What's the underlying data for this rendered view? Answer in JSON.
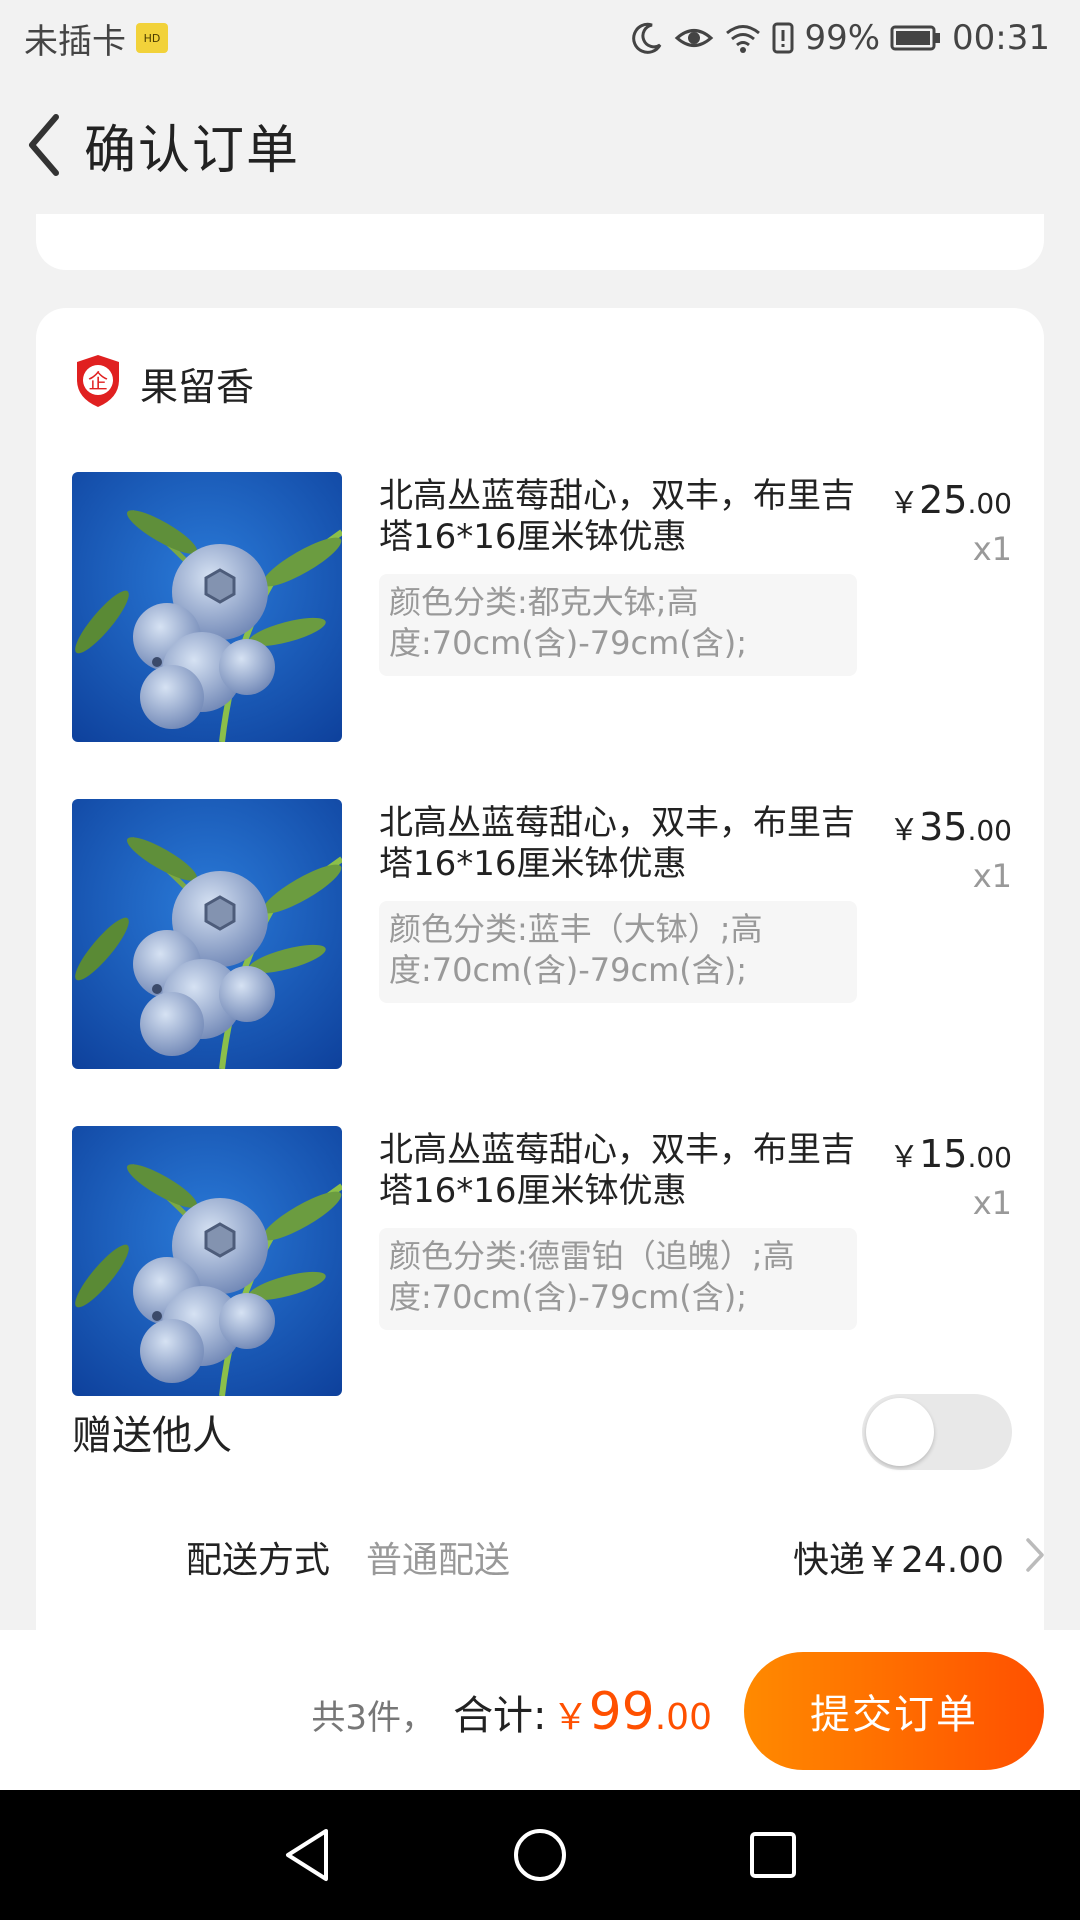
{
  "status_bar": {
    "carrier": "未插卡",
    "sim_badge": "HD",
    "battery": "99%",
    "time": "00:31",
    "icons": [
      "moon-icon",
      "eye-icon",
      "wifi-icon",
      "alert-icon",
      "battery-icon"
    ]
  },
  "header": {
    "back_icon": "chevron-left-icon",
    "title": "确认订单"
  },
  "shop": {
    "icon": "enterprise-shield-icon",
    "badge_char": "企",
    "name": "果留香"
  },
  "items": [
    {
      "title": "北高丛蓝莓甜心，双丰，布里吉塔16*16厘米钵优惠",
      "sku": "颜色分类:都克大钵;高度:70cm(含)-79cm(含);",
      "price_symbol": "￥",
      "price_int": "25",
      "price_dec": ".00",
      "qty": "x1"
    },
    {
      "title": "北高丛蓝莓甜心，双丰，布里吉塔16*16厘米钵优惠",
      "sku": "颜色分类:蓝丰（大钵）;高度:70cm(含)-79cm(含);",
      "price_symbol": "￥",
      "price_int": "35",
      "price_dec": ".00",
      "qty": "x1"
    },
    {
      "title": "北高丛蓝莓甜心，双丰，布里吉塔16*16厘米钵优惠",
      "sku": "颜色分类:德雷铂（追魄）;高度:70cm(含)-79cm(含);",
      "price_symbol": "￥",
      "price_int": "15",
      "price_dec": ".00",
      "qty": "x1"
    }
  ],
  "gift": {
    "label": "赠送他人",
    "enabled": false
  },
  "shipping": {
    "label": "配送方式",
    "method": "普通配送",
    "price": "快递￥24.00",
    "chevron_icon": "chevron-right-icon"
  },
  "footer": {
    "count_text": "共3件，",
    "total_label": "合计:",
    "total_symbol": "￥",
    "total_int": "99",
    "total_dec": ".00",
    "submit_label": "提交订单"
  },
  "colors": {
    "accent": "#ff5000",
    "accent_light": "#ff8a00",
    "background": "#f2f2f2",
    "muted_text": "#999999",
    "shop_badge": "#e02020"
  }
}
